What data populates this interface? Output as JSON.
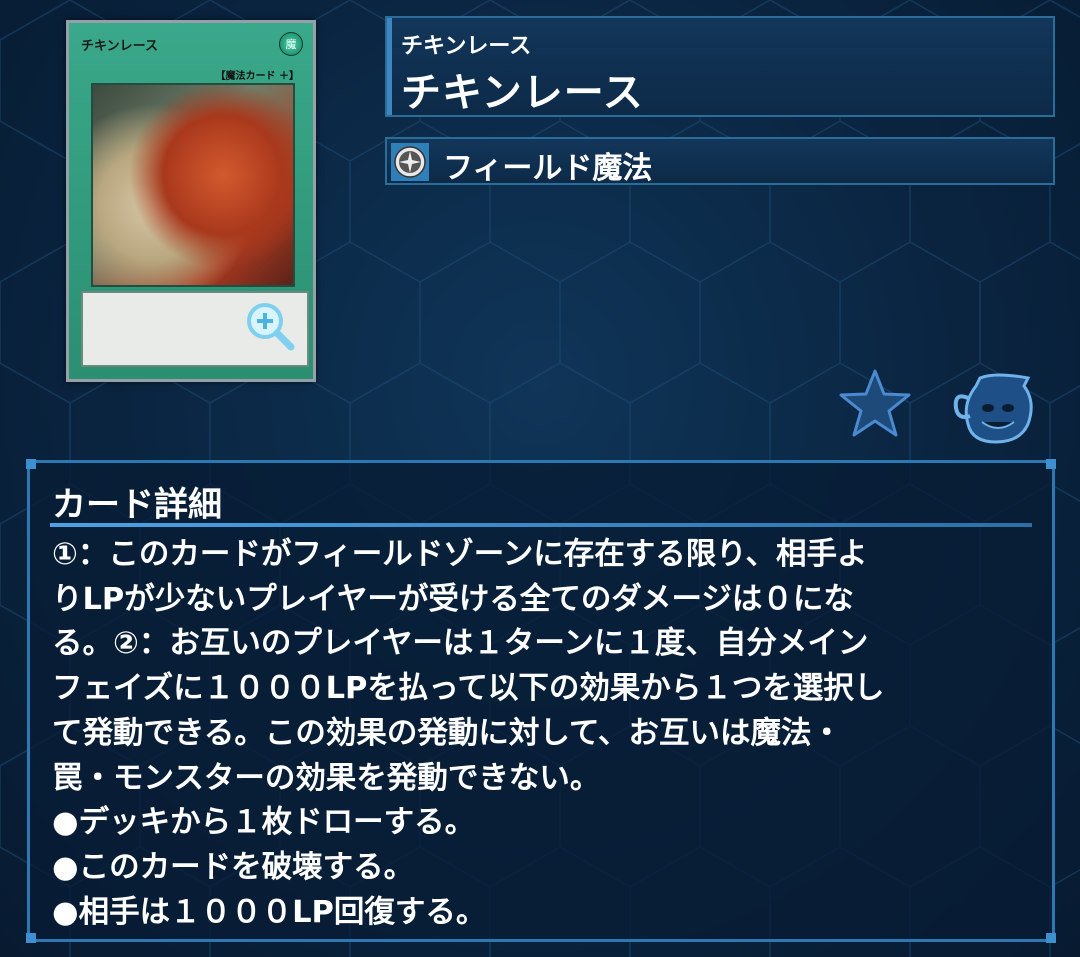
{
  "card": {
    "image_title": "チキンレース",
    "image_attribute": "魔",
    "image_type": "【魔法カード ＋】"
  },
  "name_box": {
    "ruby": "チキンレース",
    "name": "チキンレース"
  },
  "type_box": {
    "icon": "field-spell-icon",
    "label": "フィールド魔法"
  },
  "actions": {
    "favorite_icon": "star-icon",
    "collection_icon": "pot-icon"
  },
  "details": {
    "title": "カード詳細",
    "lines": [
      "①：このカードがフィールドゾーンに存在する限り、相手よ",
      "りLPが少ないプレイヤーが受ける全てのダメージは０にな",
      "る。②：お互いのプレイヤーは１ターンに１度、自分メイン",
      "フェイズに１０００LPを払って以下の効果から１つを選択し",
      "て発動できる。この効果の発動に対して、お互いは魔法・",
      "罠・モンスターの効果を発動できない。",
      "●デッキから１枚ドローする。",
      "●このカードを破壊する。",
      "●相手は１０００LP回復する。"
    ]
  },
  "colors": {
    "background": "#0a2440",
    "frame": "#2c78b3",
    "spell_card": "#2b8f72"
  }
}
